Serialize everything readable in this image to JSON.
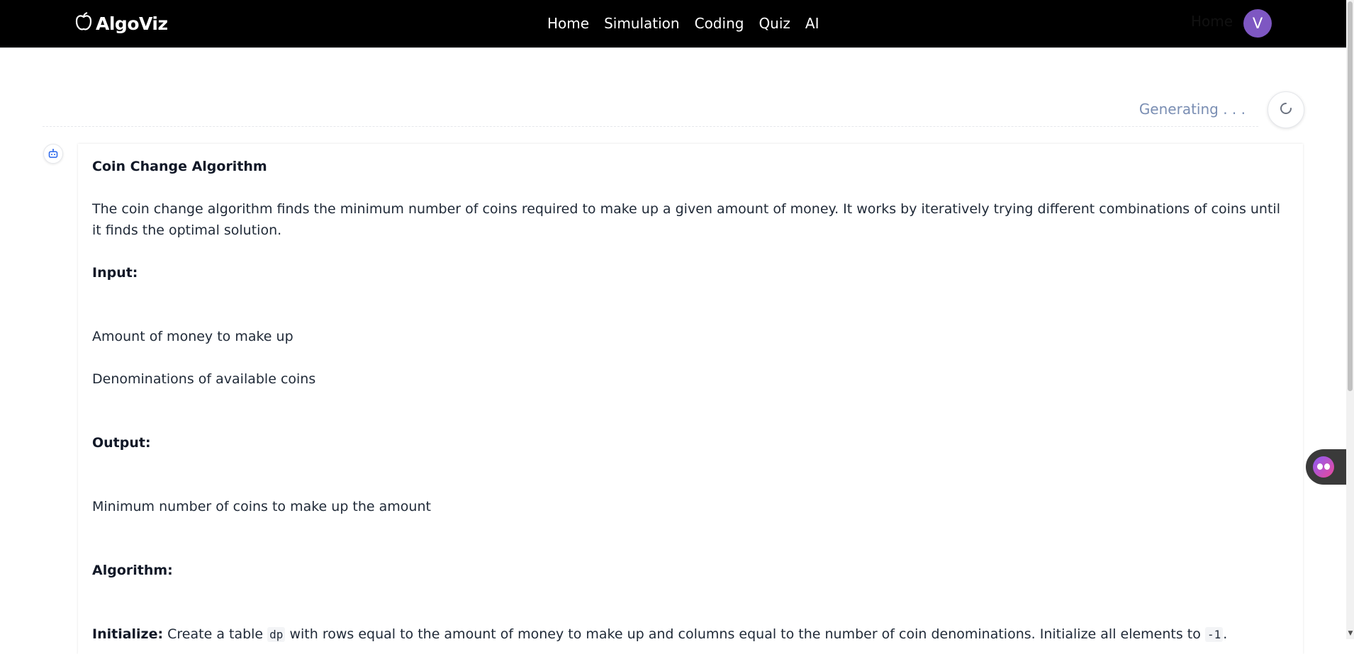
{
  "header": {
    "logo_text": "AlgoViz",
    "nav_items": [
      "Home",
      "Simulation",
      "Coding",
      "Quiz",
      "AI"
    ],
    "ghost_link": "Home",
    "avatar_initial": "V"
  },
  "status": {
    "generating_text": "Generating . . ."
  },
  "response": {
    "title": "Coin Change Algorithm",
    "intro": "The coin change algorithm finds the minimum number of coins required to make up a given amount of money. It works by iteratively trying different combinations of coins until it finds the optimal solution.",
    "input_heading": "Input:",
    "input_items": [
      "Amount of money to make up",
      "Denominations of available coins"
    ],
    "output_heading": "Output:",
    "output_items": [
      "Minimum number of coins to make up the amount"
    ],
    "algorithm_heading": "Algorithm:",
    "step1": {
      "label": "Initialize:",
      "text_a": "Create a table",
      "code_a": "dp",
      "text_b": "with rows equal to the amount of money to make up and columns equal to the number of coin denominations. Initialize all elements to",
      "code_b": "-1",
      "text_c": "."
    }
  },
  "icons": {
    "logo": "apple-icon",
    "spinner": "loading-spinner-icon",
    "bot": "robot-icon",
    "widget": "assistant-widget-icon"
  },
  "colors": {
    "navbar_bg": "#000000",
    "avatar_bg": "#7e57c2",
    "generating_text": "#7a8eb3"
  }
}
